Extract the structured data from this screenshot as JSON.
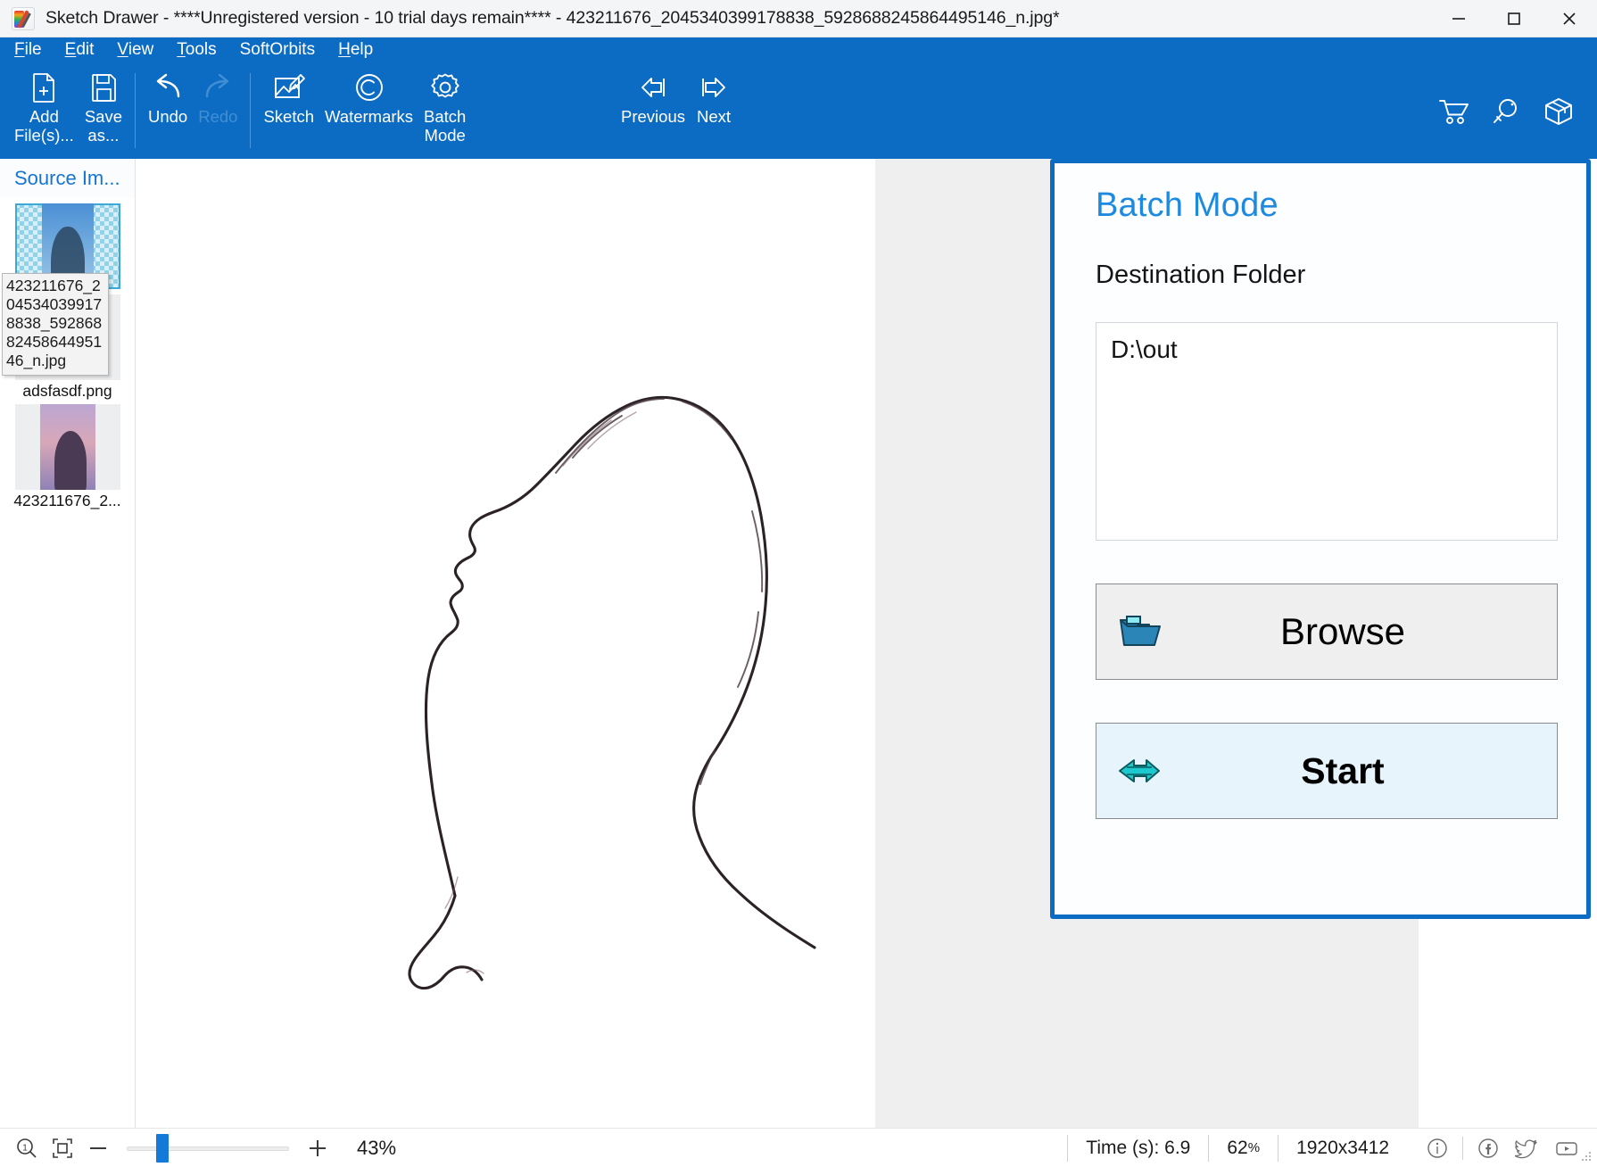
{
  "window": {
    "title": "Sketch Drawer - ****Unregistered version - 10 trial days remain**** - 423211676_2045340399178838_5928688245864495146_n.jpg*",
    "app_icon": "sketch-drawer-palette-icon",
    "controls": {
      "minimize": "minimize-icon",
      "maximize": "maximize-icon",
      "close": "close-icon"
    }
  },
  "menu": {
    "items": [
      {
        "label": "File",
        "mnemonic": "F"
      },
      {
        "label": "Edit",
        "mnemonic": "E"
      },
      {
        "label": "View",
        "mnemonic": "V"
      },
      {
        "label": "Tools",
        "mnemonic": "T"
      },
      {
        "label": "SoftOrbits",
        "mnemonic": ""
      },
      {
        "label": "Help",
        "mnemonic": "H"
      }
    ]
  },
  "toolbar": {
    "buttons": [
      {
        "label": "Add\nFile(s)...",
        "icon": "add-file-icon",
        "disabled": false
      },
      {
        "label": "Save\nas...",
        "icon": "save-icon",
        "disabled": false
      },
      {
        "label": "Undo",
        "icon": "undo-icon",
        "disabled": false
      },
      {
        "label": "Redo",
        "icon": "redo-icon",
        "disabled": true
      },
      {
        "label": "Sketch",
        "icon": "sketch-icon",
        "disabled": false
      },
      {
        "label": "Watermarks",
        "icon": "copyright-icon",
        "disabled": false
      },
      {
        "label": "Batch\nMode",
        "icon": "gear-icon",
        "disabled": false
      }
    ],
    "nav": [
      {
        "label": "Previous",
        "icon": "arrow-left-icon"
      },
      {
        "label": "Next",
        "icon": "arrow-right-icon"
      }
    ],
    "right_icons": [
      {
        "name": "cart-icon"
      },
      {
        "name": "key-icon"
      },
      {
        "name": "package-box-icon"
      }
    ]
  },
  "sidebar": {
    "header": "Source Im...",
    "thumbnails": [
      {
        "label": "",
        "selected": true,
        "kind": "portrait-blue"
      },
      {
        "label": "adsfasdf.png",
        "selected": false,
        "kind": "landscape-warm"
      },
      {
        "label": "423211676_2...",
        "selected": false,
        "kind": "portrait-sunset"
      }
    ],
    "tooltip": "423211676_2045340399178838_5928688245864495146_n.jpg"
  },
  "batch_panel": {
    "title": "Batch Mode",
    "subtitle": "Destination Folder",
    "destination_value": "D:\\out",
    "destination_placeholder": "",
    "browse_label": "Browse",
    "browse_icon": "folder-open-icon",
    "start_label": "Start",
    "start_icon": "double-arrow-right-icon",
    "accent_color": "#0c6cc4",
    "title_color": "#1d8ae0",
    "start_bg": "#e8f4fc"
  },
  "statusbar": {
    "zoom_one_to_one_icon": "zoom-actual-size-icon",
    "fit_screen_icon": "fit-to-screen-icon",
    "zoom_out_icon": "minus-icon",
    "zoom_in_icon": "plus-icon",
    "zoom_value": "43%",
    "slider_position_pct": 18,
    "time_label": "Time (s): 6.9",
    "progress_value": "62",
    "progress_unit": "%",
    "dimensions": "1920x3412",
    "icons": [
      {
        "name": "info-icon"
      },
      {
        "name": "facebook-icon"
      },
      {
        "name": "twitter-icon"
      },
      {
        "name": "youtube-icon"
      }
    ]
  }
}
